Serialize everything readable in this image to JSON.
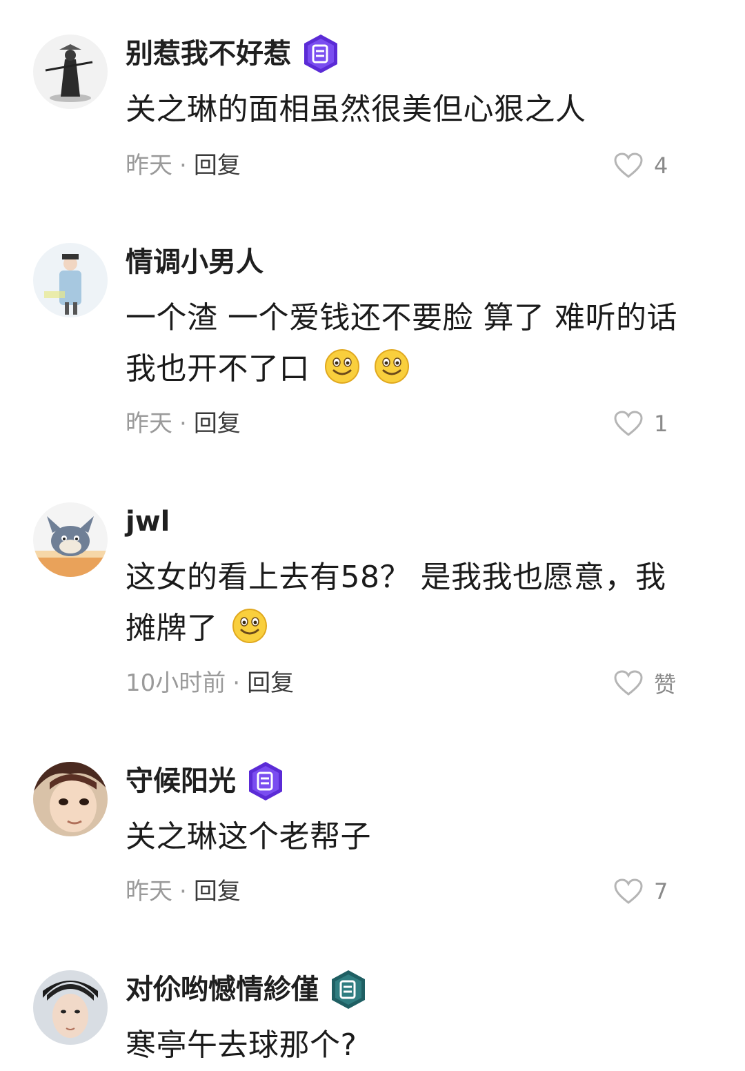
{
  "comments": [
    {
      "username": "别惹我不好惹",
      "text_line1": "关之琳的面相虽然很美但心狠之人",
      "text_line2": "",
      "time": "昨天",
      "reply": "回复",
      "likes": "4"
    },
    {
      "username": "情调小男人",
      "text_line1": "一个渣 一个爱钱还不要脸 算了 难听的话",
      "text_line2": "我也开不了口",
      "time": "昨天",
      "reply": "回复",
      "likes": "1"
    },
    {
      "username": "jwl",
      "text_line1": "这女的看上去有58？ 是我我也愿意，我",
      "text_line2": "摊牌了",
      "time": "10小时前",
      "reply": "回复",
      "likes": "赞"
    },
    {
      "username": "守候阳光",
      "text_line1": "关之琳这个老帮子",
      "text_line2": "",
      "time": "昨天",
      "reply": "回复",
      "likes": "7"
    },
    {
      "username": "对伱哟憾情紾僅",
      "text_line1": "寒亭午去球那个?",
      "text_line2": "",
      "time": "",
      "reply": "",
      "likes": ""
    }
  ],
  "dot": "·",
  "colors": {
    "badge_purple": "#5b2bd6",
    "badge_teal": "#1f5f63",
    "meta_gray": "#9a9a9a",
    "heart_gray": "#b5b5b5"
  },
  "icons": {
    "like": "heart-outline-icon",
    "badge": "scroll-badge-icon",
    "emoji": "smile-emoji-icon"
  }
}
